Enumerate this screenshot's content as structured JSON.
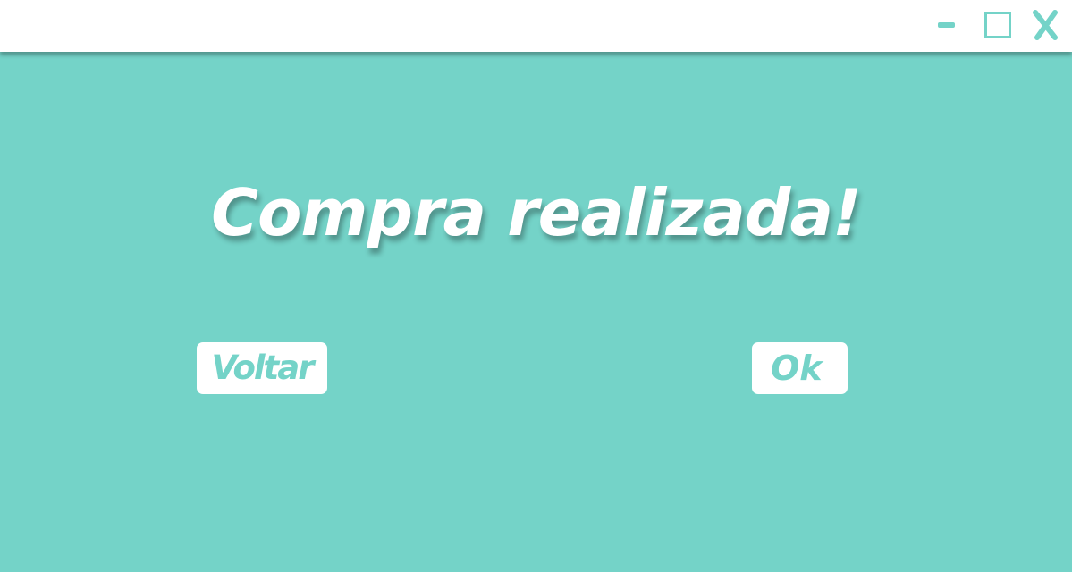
{
  "window": {
    "controls": {
      "minimize": "minimize-icon",
      "maximize": "maximize-icon",
      "close": "close-icon"
    }
  },
  "main": {
    "headline": "Compra realizada!",
    "back_button_label": "Voltar",
    "ok_button_label": "Ok"
  },
  "colors": {
    "background": "#74d3c8",
    "titlebar": "#ffffff",
    "button_background": "#ffffff",
    "button_text": "#74d3c8",
    "headline_text": "#ffffff"
  }
}
